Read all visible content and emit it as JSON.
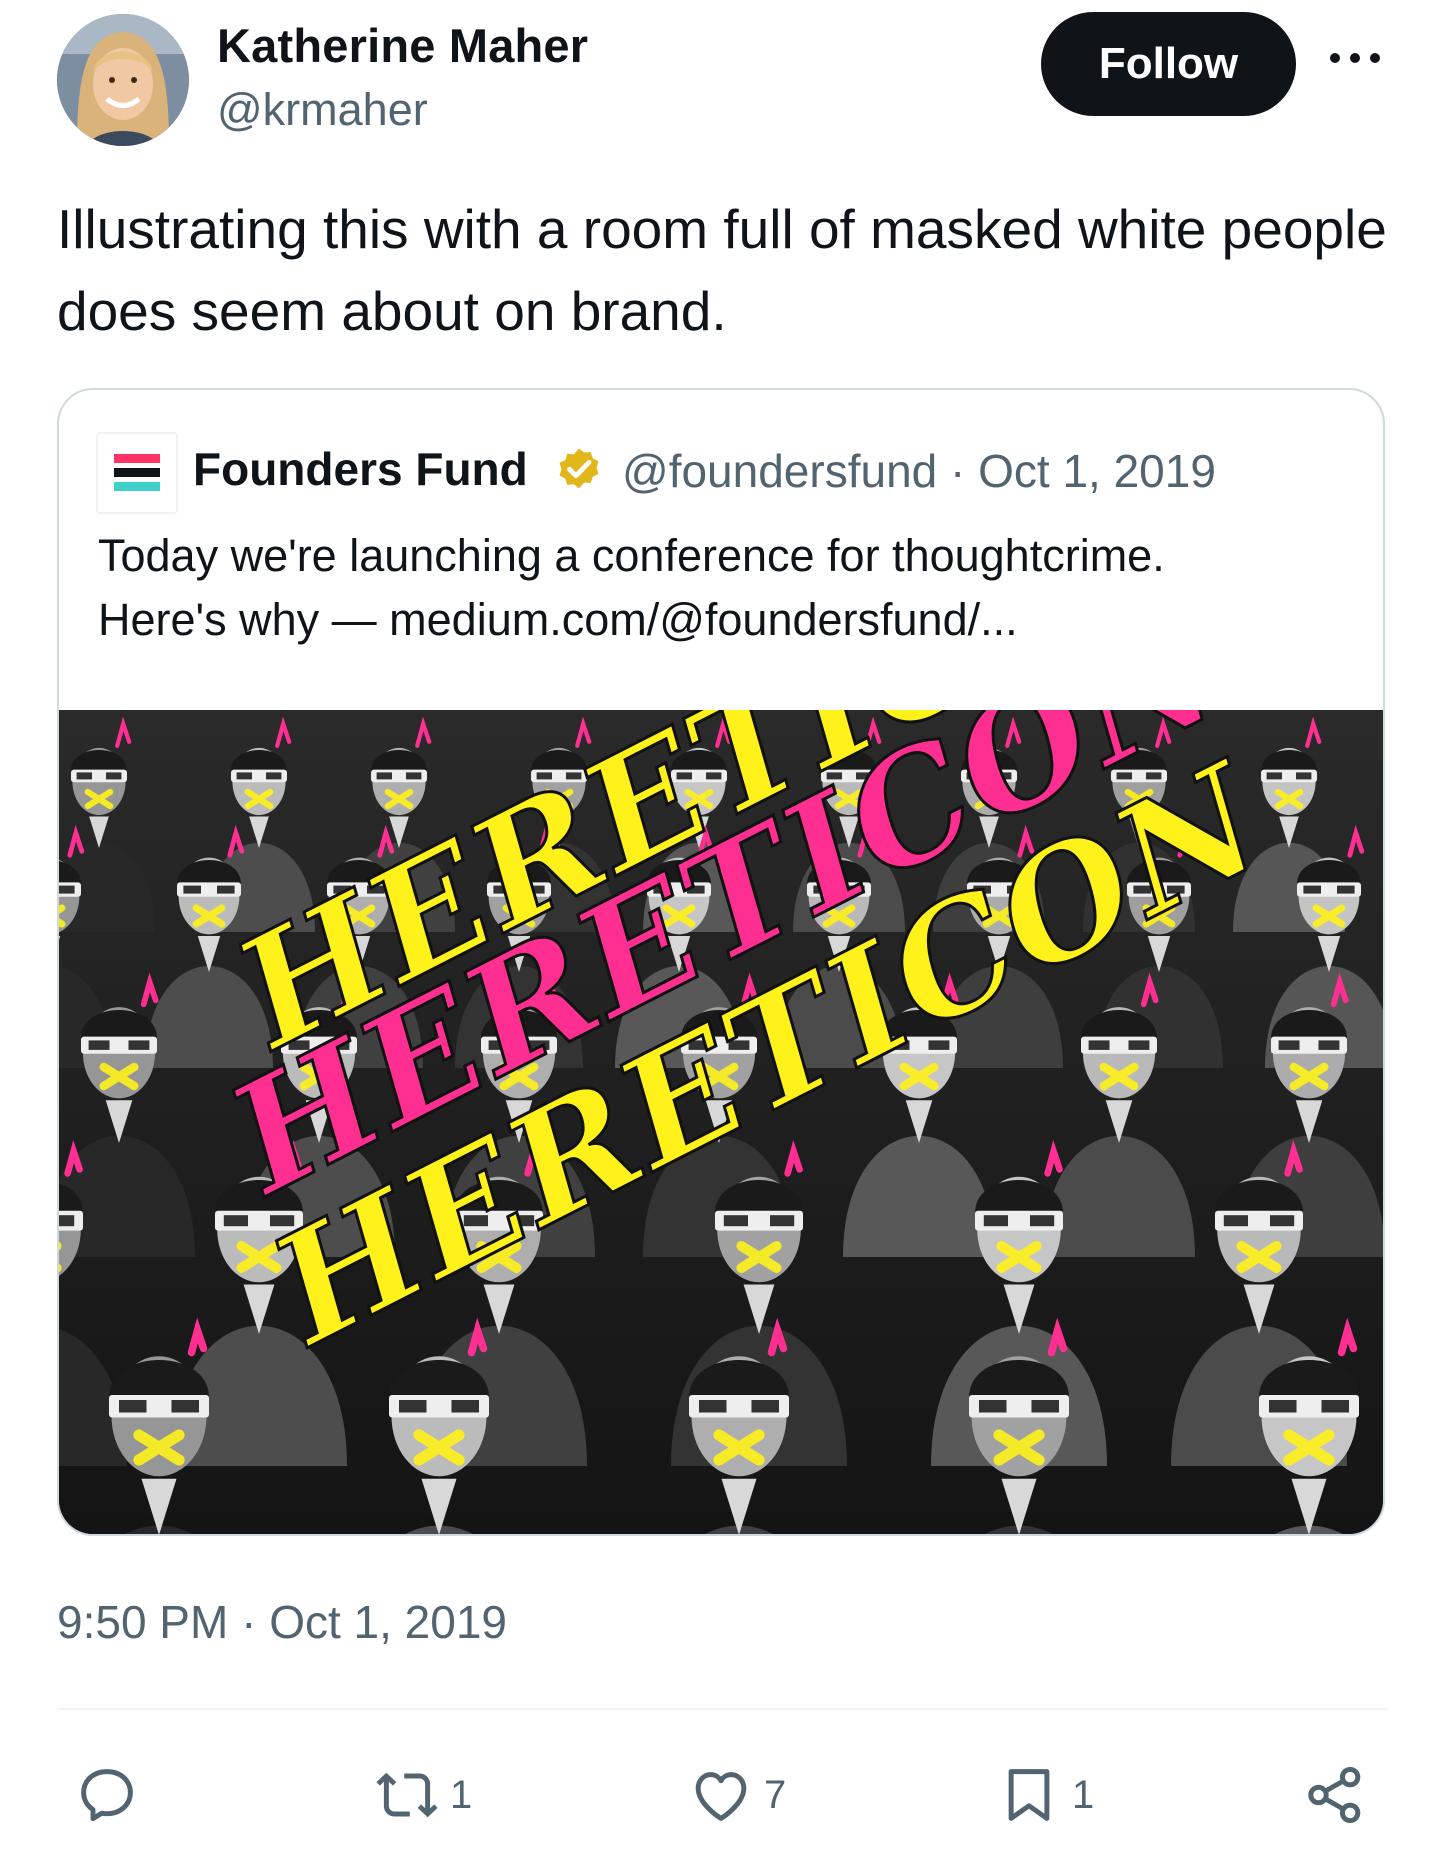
{
  "author": {
    "name": "Katherine Maher",
    "handle": "@krmaher",
    "follow_label": "Follow"
  },
  "tweet": {
    "text": "Illustrating this with a room full of masked white people does seem about on brand.",
    "timestamp": "9:50 PM · Oct 1, 2019"
  },
  "quote": {
    "name": "Founders Fund",
    "handle_date": "@foundersfund · Oct 1, 2019",
    "text_line1": "Today we're launching a conference for thoughtcrime.",
    "text_line2": "Here's why — medium.com/@foundersfund/...",
    "image_words": [
      "HERETICON",
      "HERETICON",
      "HERETICON"
    ],
    "verified_color": "#e2b719",
    "logo_colors": [
      "#ff3366",
      "#0f1419",
      "#3fd0c9"
    ]
  },
  "actions": {
    "reply": {
      "icon": "reply-icon",
      "count": ""
    },
    "retweet": {
      "icon": "retweet-icon",
      "count": "1"
    },
    "like": {
      "icon": "heart-icon",
      "count": "7"
    },
    "bookmark": {
      "icon": "bookmark-icon",
      "count": "1"
    },
    "share": {
      "icon": "share-icon",
      "count": ""
    }
  },
  "colors": {
    "text": "#0f1419",
    "secondary": "#536471",
    "border": "#cfd9de",
    "poster_yellow": "#fff21a",
    "poster_pink": "#ff2f92"
  }
}
